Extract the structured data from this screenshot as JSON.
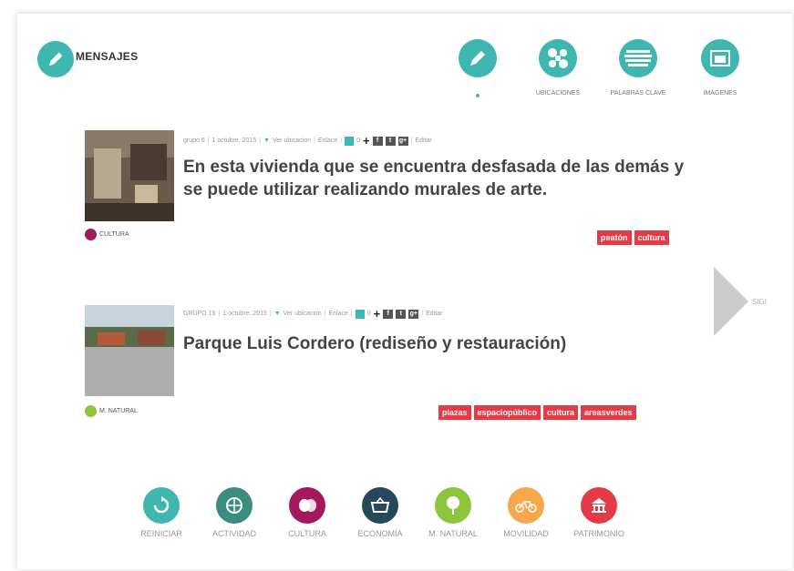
{
  "header": {
    "title": "MENSAJES",
    "nav": [
      {
        "label": "",
        "icon": "pencil-icon"
      },
      {
        "label": "UBICACIONES",
        "icon": "locations-icon"
      },
      {
        "label": "PALABRAS CLAVE",
        "icon": "wordcloud-icon"
      },
      {
        "label": "IMAGENES",
        "icon": "image-icon"
      }
    ]
  },
  "posts": [
    {
      "group": "grupo 6",
      "date": "1 octubre, 2015",
      "location_link": "Ver ubicacion",
      "link": "Enlace",
      "likes": "0",
      "edit": "Editar",
      "text": "En esta vivienda que se encuentra desfasada de las demás y se puede utilizar realizando murales de arte.",
      "category": "CULTURA",
      "category_color": "#a3195b",
      "tags": [
        "peatón",
        "cultura"
      ]
    },
    {
      "group": "GRUPO 15",
      "date": "1 octubre, 2015",
      "location_link": "Ver ubicacion",
      "link": "Enlace",
      "likes": "0",
      "edit": "Editar",
      "text": "Parque Luis Cordero (rediseño y restauración)",
      "category": "M. NATURAL",
      "category_color": "#8cc63f",
      "tags": [
        "plazas",
        "espaciopúblico",
        "cultura",
        "areasverdes"
      ]
    }
  ],
  "social": [
    "f",
    "t",
    "g+"
  ],
  "next_label": "SIGI",
  "bottom_nav": [
    {
      "label": "REINICIAR",
      "color": "#3fb6b0",
      "icon": "reset-icon"
    },
    {
      "label": "ACTIVIDAD",
      "color": "#3a8d7f",
      "icon": "activity-icon"
    },
    {
      "label": "CULTURA",
      "color": "#a3195b",
      "icon": "theater-masks-icon"
    },
    {
      "label": "ECONOMÍA",
      "color": "#25485a",
      "icon": "basket-icon"
    },
    {
      "label": "M. NATURAL",
      "color": "#8cc63f",
      "icon": "tree-icon"
    },
    {
      "label": "MOVILIDAD",
      "color": "#f5a94a",
      "icon": "bicycle-icon"
    },
    {
      "label": "PATRIMONIO",
      "color": "#e53b47",
      "icon": "monument-icon"
    }
  ]
}
